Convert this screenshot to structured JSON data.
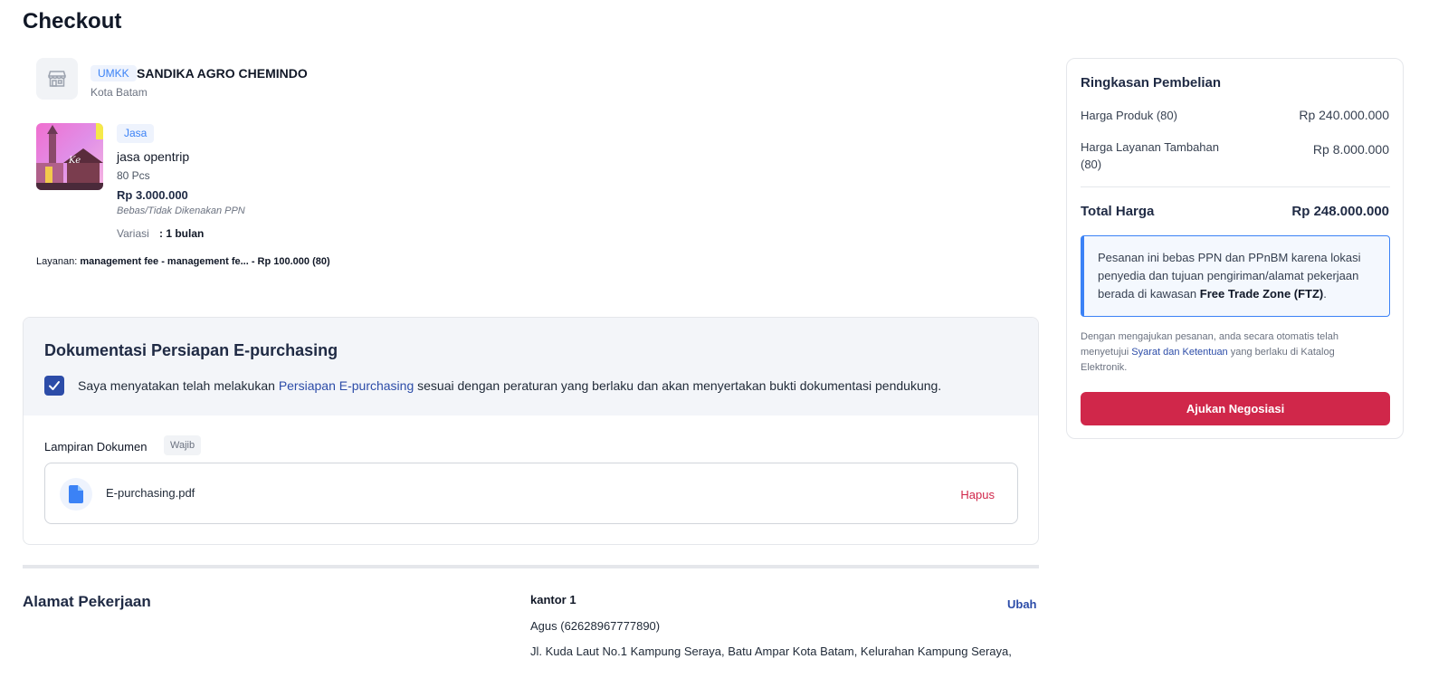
{
  "page": {
    "title": "Checkout"
  },
  "seller": {
    "badge": "UMKK",
    "name": "SANDIKA AGRO CHEMINDO",
    "city": "Kota Batam",
    "icon": "store-icon"
  },
  "product": {
    "badge": "Jasa",
    "name": "jasa opentrip",
    "qty": "80 Pcs",
    "price": "Rp 3.000.000",
    "tax_note": "Bebas/Tidak Dikenakan PPN",
    "variant_label": "Variasi",
    "variant_value": ": 1 bulan",
    "service_label": "Layanan:",
    "service_value": "management fee - management fe... - Rp 100.000 (80)"
  },
  "epurchasing": {
    "title": "Dokumentasi Persiapan E-purchasing",
    "checked": true,
    "statement_before": "Saya menyatakan telah melakukan ",
    "statement_link": "Persiapan E-purchasing",
    "statement_after": " sesuai dengan peraturan yang berlaku dan akan menyertakan bukti dokumentasi pendukung.",
    "attachment_label": "Lampiran Dokumen",
    "required_badge": "Wajib",
    "file_name": "E-purchasing.pdf",
    "delete_label": "Hapus"
  },
  "address": {
    "title": "Alamat Pekerjaan",
    "name": "kantor 1",
    "contact": "Agus (62628967777890)",
    "line": "Jl. Kuda Laut No.1 Kampung Seraya, Batu Ampar Kota Batam, Kelurahan Kampung Seraya,",
    "edit_label": "Ubah"
  },
  "summary": {
    "title": "Ringkasan Pembelian",
    "rows": [
      {
        "label": "Harga Produk (80)",
        "value": "Rp 240.000.000"
      },
      {
        "label": "Harga Layanan Tambahan",
        "label2": "(80)",
        "value": "Rp 8.000.000"
      }
    ],
    "total_label": "Total Harga",
    "total_value": "Rp 248.000.000",
    "ftz_text_before": "Pesanan ini bebas PPN dan PPnBM karena lokasi penyedia dan tujuan pengiriman/alamat pekerjaan berada di kawasan ",
    "ftz_text_bold": "Free Trade Zone (FTZ)",
    "ftz_text_after": ".",
    "agree_before": "Dengan mengajukan pesanan, anda secara otomatis telah menyetujui ",
    "agree_link": "Syarat dan Ketentuan",
    "agree_after": " yang berlaku di Katalog Elektronik.",
    "submit_label": "Ajukan Negosiasi"
  },
  "colors": {
    "primary_blue": "#2c4ca8",
    "accent_red": "#d0274a",
    "info_blue": "#3b82f6"
  }
}
